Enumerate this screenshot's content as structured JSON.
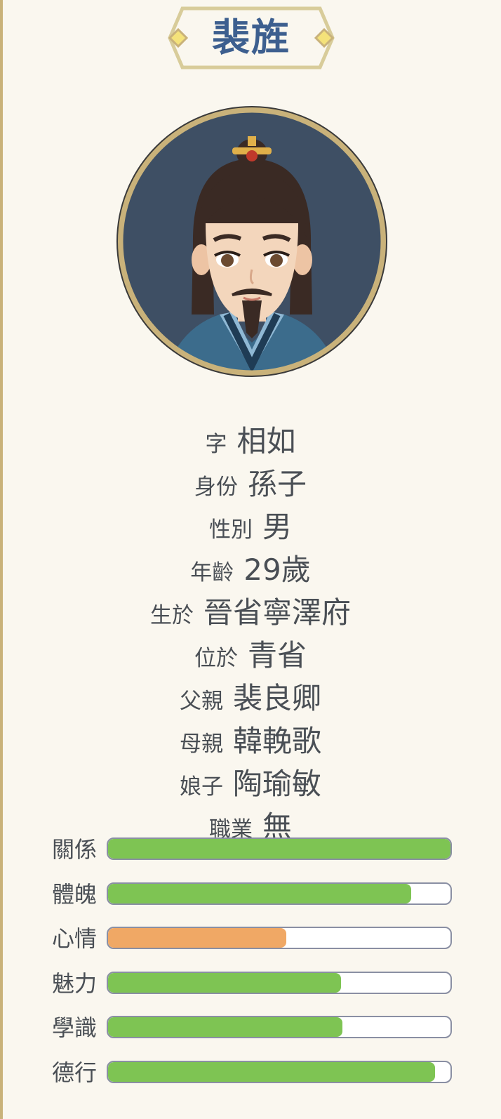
{
  "character": {
    "name": "裴旌"
  },
  "info": [
    {
      "label": "字",
      "value": "相如"
    },
    {
      "label": "身份",
      "value": "孫子"
    },
    {
      "label": "性別",
      "value": "男"
    },
    {
      "label": "年齡",
      "value": "29歲"
    },
    {
      "label": "生於",
      "value": "晉省寧澤府"
    },
    {
      "label": "位於",
      "value": "青省"
    },
    {
      "label": "父親",
      "value": "裴良卿"
    },
    {
      "label": "母親",
      "value": "韓輓歌"
    },
    {
      "label": "娘子",
      "value": "陶瑜敏"
    },
    {
      "label": "職業",
      "value": "無"
    }
  ],
  "stats": [
    {
      "label": "關係",
      "level": 1.0,
      "color": "#7ec453"
    },
    {
      "label": "體魄",
      "level": 0.885,
      "color": "#7ec453"
    },
    {
      "label": "心情",
      "level": 0.52,
      "color": "#f0a865"
    },
    {
      "label": "魅力",
      "level": 0.68,
      "color": "#7ec453"
    },
    {
      "label": "學識",
      "level": 0.685,
      "color": "#7ec453"
    },
    {
      "label": "德行",
      "level": 0.955,
      "color": "#7ec453"
    }
  ],
  "colors": {
    "accent_gold": "#c9b27a",
    "name_blue": "#3d5f8f",
    "portrait_bg": "#3e4f64"
  }
}
